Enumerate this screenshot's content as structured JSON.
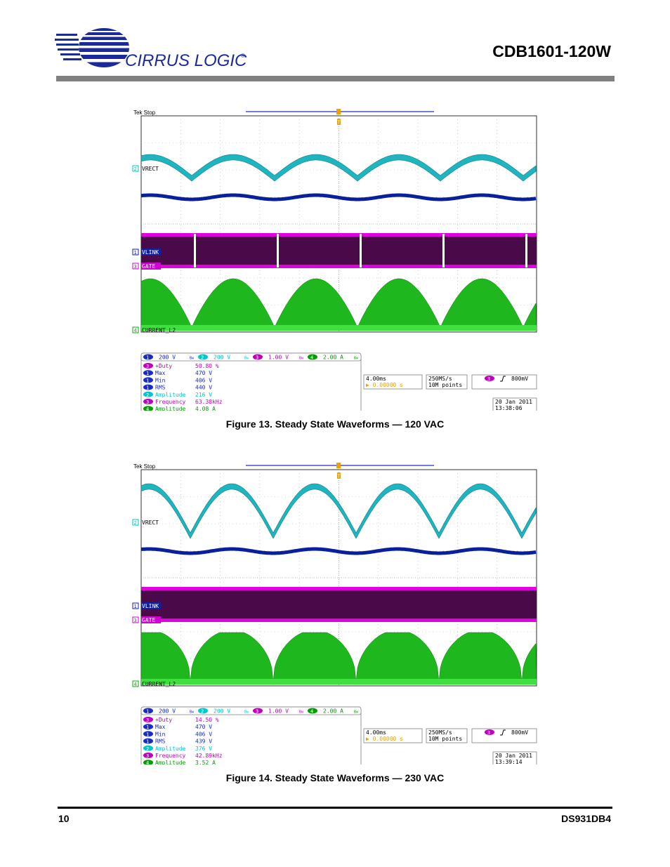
{
  "header": {
    "brand": "CIRRUS LOGIC",
    "trademark": "®",
    "doc_title": "CDB1601-120W"
  },
  "footer": {
    "page_number": "10",
    "doc_id": "DS931DB4"
  },
  "figures": [
    {
      "caption": "Figure 13.  Steady State Waveforms — 120 VAC",
      "scope": {
        "status": "Tek Stop",
        "trigger_marker": "T",
        "channel_labels": [
          {
            "num": "2",
            "text": "VRECT",
            "color": "#00c8c8"
          },
          {
            "num": "1",
            "text": "VLINK",
            "color": "#1020a0"
          },
          {
            "num": "3",
            "text": "GATE",
            "color": "#d000d0"
          },
          {
            "num": "4",
            "text": "CURRENT_L2",
            "color": "#00b000"
          }
        ],
        "scales": [
          {
            "num": "1",
            "value": "200 V",
            "bw": "Bw",
            "color": "#1a2cc8"
          },
          {
            "num": "2",
            "value": "200 V",
            "bw": "Bw",
            "color": "#00c8c8"
          },
          {
            "num": "3",
            "value": "1.00 V",
            "bw": "Bw",
            "color": "#c000c0"
          },
          {
            "num": "4",
            "value": "2.00 A",
            "bw": "Bw",
            "color": "#00a000"
          }
        ],
        "measurements": [
          {
            "num": "3",
            "name": "+Duty",
            "value": "50.80 %",
            "color": "#c000c0"
          },
          {
            "num": "1",
            "name": "Max",
            "value": "470 V",
            "color": "#1a2cc8"
          },
          {
            "num": "1",
            "name": "Min",
            "value": "406 V",
            "color": "#1a2cc8"
          },
          {
            "num": "1",
            "name": "RMS",
            "value": "440 V",
            "color": "#1a2cc8"
          },
          {
            "num": "2",
            "name": "Amplitude",
            "value": "216 V",
            "color": "#00c8c8"
          },
          {
            "num": "3",
            "name": "Frequency",
            "value": "63.38kHz",
            "color": "#c000c0"
          },
          {
            "num": "4",
            "name": "Amplitude",
            "value": "4.08 A",
            "color": "#00a000"
          }
        ],
        "timebase": "4.00ms",
        "trigger_pos": "▶ 0.00000 s",
        "sample_rate": "250MS/s",
        "record_length": "10M points",
        "trigger_ch": "3",
        "trigger_level": "800mV",
        "date": "20 Jan  2011",
        "time": "13:38:06"
      }
    },
    {
      "caption": "Figure 14.  Steady State Waveforms — 230 VAC",
      "scope": {
        "status": "Tek Stop",
        "trigger_marker": "T",
        "channel_labels": [
          {
            "num": "2",
            "text": "VRECT",
            "color": "#00c8c8"
          },
          {
            "num": "1",
            "text": "VLINK",
            "color": "#1020a0"
          },
          {
            "num": "3",
            "text": "GATE",
            "color": "#d000d0"
          },
          {
            "num": "4",
            "text": "CURRENT_L2",
            "color": "#00b000"
          }
        ],
        "scales": [
          {
            "num": "1",
            "value": "200 V",
            "bw": "Bw",
            "color": "#1a2cc8"
          },
          {
            "num": "2",
            "value": "200 V",
            "bw": "Bw",
            "color": "#00c8c8"
          },
          {
            "num": "3",
            "value": "1.00 V",
            "bw": "Bw",
            "color": "#c000c0"
          },
          {
            "num": "4",
            "value": "2.00 A",
            "bw": "Bw",
            "color": "#00a000"
          }
        ],
        "measurements": [
          {
            "num": "3",
            "name": "+Duty",
            "value": "14.50 %",
            "color": "#c000c0"
          },
          {
            "num": "1",
            "name": "Max",
            "value": "470 V",
            "color": "#1a2cc8"
          },
          {
            "num": "1",
            "name": "Min",
            "value": "406 V",
            "color": "#1a2cc8"
          },
          {
            "num": "1",
            "name": "RMS",
            "value": "439 V",
            "color": "#1a2cc8"
          },
          {
            "num": "2",
            "name": "Amplitude",
            "value": "376 V",
            "color": "#00c8c8"
          },
          {
            "num": "3",
            "name": "Frequency",
            "value": "42.89kHz",
            "color": "#c000c0"
          },
          {
            "num": "4",
            "name": "Amplitude",
            "value": "3.52 A",
            "color": "#00a000"
          }
        ],
        "timebase": "4.00ms",
        "trigger_pos": "▶ 0.00000 s",
        "sample_rate": "250MS/s",
        "record_length": "10M points",
        "trigger_ch": "3",
        "trigger_level": "800mV",
        "date": "20 Jan  2011",
        "time": "13:39:14"
      }
    }
  ],
  "colors": {
    "vrect": "#1fb5c0",
    "vlink": "#0a1f9a",
    "gate_fill": "#4a0a4a",
    "gate_edge": "#e000e0",
    "current": "#1eb81e",
    "grid": "#b0b0b0"
  }
}
